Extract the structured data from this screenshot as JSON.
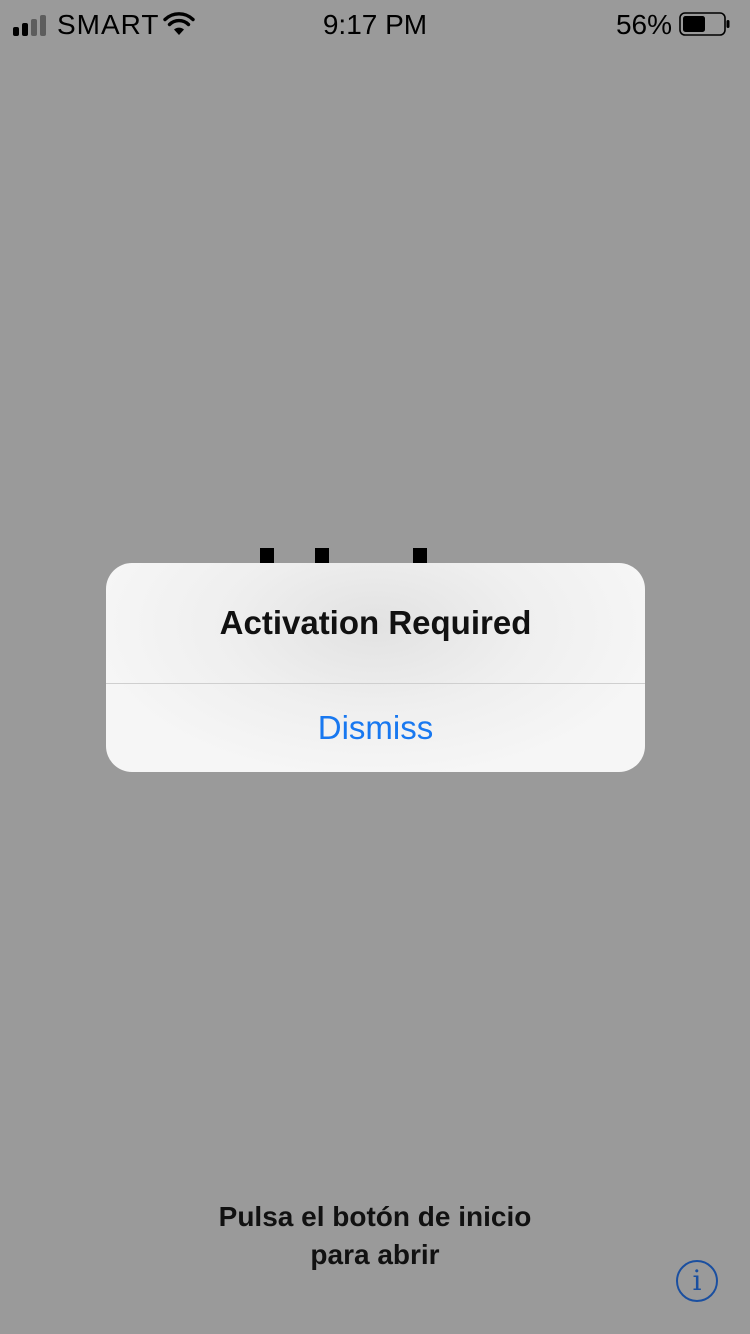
{
  "status_bar": {
    "carrier": "SMART",
    "time": "9:17 PM",
    "battery_percent": "56%",
    "battery_level": 0.56,
    "signal_bars_active": 2,
    "signal_bars_total": 4,
    "icons": [
      "signal-icon",
      "wifi-icon",
      "battery-icon"
    ]
  },
  "alert": {
    "title": "Activation Required",
    "dismiss_label": "Dismiss",
    "accent_color": "#1878f0"
  },
  "home_prompt": {
    "line1": "Pulsa el botón de inicio",
    "line2": "para abrir"
  },
  "info_button": {
    "icon": "info-icon",
    "glyph": "i"
  }
}
